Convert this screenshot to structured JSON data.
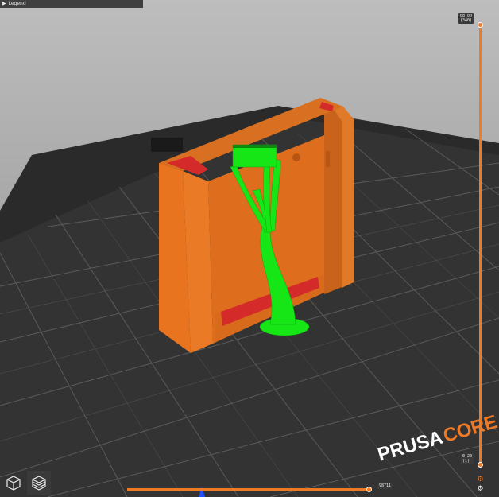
{
  "legend": {
    "toggle_icon": "triangle-right-icon",
    "label": "Legend"
  },
  "vertical_slider": {
    "top": {
      "height": "68.00",
      "layer": "(340)"
    },
    "bottom": {
      "height": "0.20",
      "layer": "(1)"
    },
    "icons": [
      "cog-icon",
      "settings-icon"
    ]
  },
  "horizontal_slider": {
    "value": "98711"
  },
  "bed": {
    "logo_prusa": "PRUSA",
    "logo_core": "CORE"
  },
  "view_buttons": [
    {
      "name": "3d-view-button",
      "icon": "cube-icon"
    },
    {
      "name": "layers-view-button",
      "icon": "layers-icon"
    }
  ],
  "colors": {
    "model": "#e8741f",
    "support": "#16e516",
    "top_surface": "#d42a2a",
    "accent": "#ef7a26",
    "bed": "#2b2b2b"
  }
}
